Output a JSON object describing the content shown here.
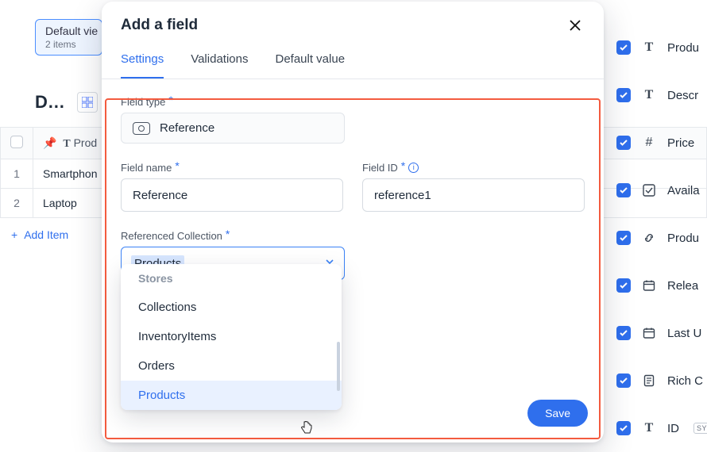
{
  "bg": {
    "view_chip_title": "Default vie",
    "view_chip_sub": "2 items",
    "collection_title": "D…",
    "columns": {
      "col0": "Prod"
    },
    "rows": [
      "Smartphon",
      "Laptop"
    ],
    "add_item": "Add Item"
  },
  "fields": [
    {
      "icon": "text",
      "label": "Produ"
    },
    {
      "icon": "text",
      "label": "Descr"
    },
    {
      "icon": "hash",
      "label": "Price"
    },
    {
      "icon": "check",
      "label": "Availa"
    },
    {
      "icon": "link",
      "label": "Produ"
    },
    {
      "icon": "calendar",
      "label": "Relea"
    },
    {
      "icon": "calendar",
      "label": "Last U"
    },
    {
      "icon": "doc",
      "label": "Rich C"
    },
    {
      "icon": "text",
      "label": "ID"
    }
  ],
  "fields_syn": "SY",
  "modal": {
    "title": "Add a field",
    "tabs": {
      "settings": "Settings",
      "validations": "Validations",
      "default": "Default value"
    },
    "field_type_label": "Field type",
    "field_type_value": "Reference",
    "field_name_label": "Field name",
    "field_name_value": "Reference",
    "field_id_label": "Field ID",
    "field_id_value": "reference1",
    "rc_label": "Referenced Collection",
    "rc_value": "Products",
    "dropdown_group": "Stores",
    "dropdown_items": [
      "Collections",
      "InventoryItems",
      "Orders",
      "Products"
    ],
    "save": "Save"
  }
}
